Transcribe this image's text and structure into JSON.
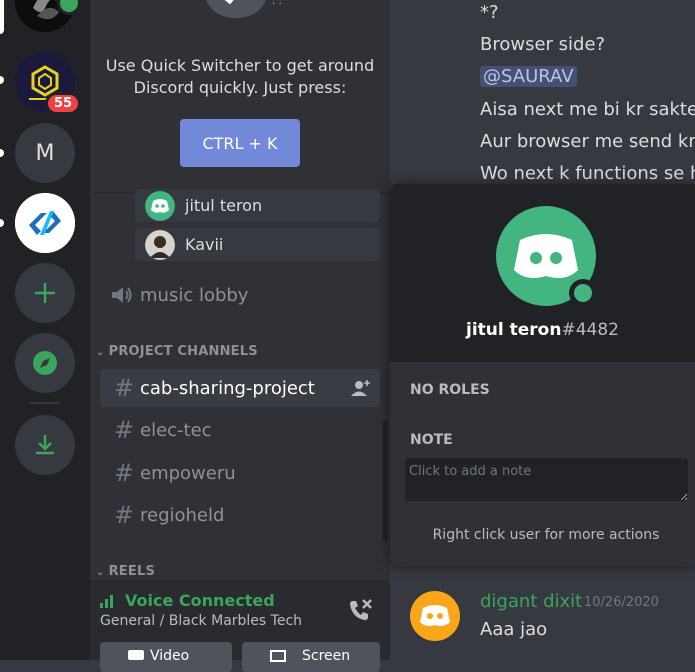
{
  "rail": {
    "guilds": [
      {
        "name": "black-marbles-server",
        "label": ""
      },
      {
        "name": "hexagon-server",
        "label": "",
        "badge": "55"
      },
      {
        "name": "m-server",
        "label": "M"
      },
      {
        "name": "blue-logo-server",
        "label": ""
      }
    ],
    "actions": [
      "add-server",
      "explore-servers",
      "download-apps"
    ]
  },
  "quick_switcher": {
    "line1": "Use Quick Switcher to get around",
    "line2": "Discord quickly. Just press:",
    "button": "CTRL + K"
  },
  "voice_users": [
    "jitul teron",
    "Kavii"
  ],
  "voice_channel": "music lobby",
  "categories": {
    "project": "PROJECT CHANNELS",
    "reels": "REELS"
  },
  "channels": [
    "cab-sharing-project",
    "elec-tec",
    "empoweru",
    "regioheld"
  ],
  "voice_connection": {
    "status": "Voice Connected",
    "location": "General / Black Marbles Tech",
    "buttons": [
      "Video",
      "Screen"
    ]
  },
  "chat": {
    "lines": [
      "*?",
      "Browser side?",
      "Aisa next me bi kr sakte h,",
      "Aur browser me send krne",
      "Wo next k functions se ho"
    ],
    "mention": "@SAURAV",
    "last_message": {
      "author": "digant dixit",
      "timestamp": "10/26/2020",
      "text": "Aaa jao"
    }
  },
  "popout": {
    "username": "jitul teron",
    "discriminator": "#4482",
    "roles_header": "NO ROLES",
    "note_header": "NOTE",
    "note_placeholder": "Click to add a note",
    "hint": "Right click user for more actions"
  },
  "colors": {
    "blurple": "#7289da",
    "green": "#3ba55c",
    "avatar_green": "#43b581",
    "badge_red": "#ed4245",
    "mention_text": "#b6c3f5"
  }
}
